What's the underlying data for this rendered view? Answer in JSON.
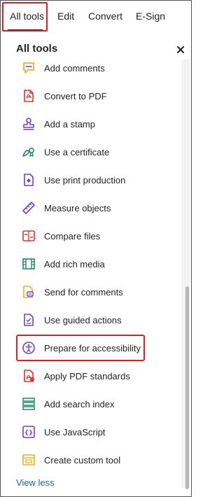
{
  "tabs": [
    "All tools",
    "Edit",
    "Convert",
    "E-Sign"
  ],
  "panel": {
    "title": "All tools",
    "close_glyph": "×"
  },
  "tools": [
    {
      "label": "Add comments",
      "icon": "comment-icon"
    },
    {
      "label": "Convert to PDF",
      "icon": "pdf-export-icon"
    },
    {
      "label": "Add a stamp",
      "icon": "stamp-icon"
    },
    {
      "label": "Use a certificate",
      "icon": "certificate-icon"
    },
    {
      "label": "Use print production",
      "icon": "print-production-icon"
    },
    {
      "label": "Measure objects",
      "icon": "ruler-icon"
    },
    {
      "label": "Compare files",
      "icon": "compare-icon"
    },
    {
      "label": "Add rich media",
      "icon": "film-icon"
    },
    {
      "label": "Send for comments",
      "icon": "send-comments-icon"
    },
    {
      "label": "Use guided actions",
      "icon": "guided-actions-icon"
    },
    {
      "label": "Prepare for accessibility",
      "icon": "accessibility-icon"
    },
    {
      "label": "Apply PDF standards",
      "icon": "pdf-standards-icon"
    },
    {
      "label": "Add search index",
      "icon": "search-index-icon"
    },
    {
      "label": "Use JavaScript",
      "icon": "javascript-icon"
    },
    {
      "label": "Create custom tool",
      "icon": "custom-tool-icon"
    }
  ],
  "footer": {
    "view_less": "View less"
  },
  "colors": {
    "highlight": "#e31b23",
    "link": "#1a5fb4",
    "icon_purple": "#6f3fd8",
    "icon_red": "#e0302e",
    "icon_green": "#1f8a64",
    "icon_yellow": "#e8b417"
  }
}
